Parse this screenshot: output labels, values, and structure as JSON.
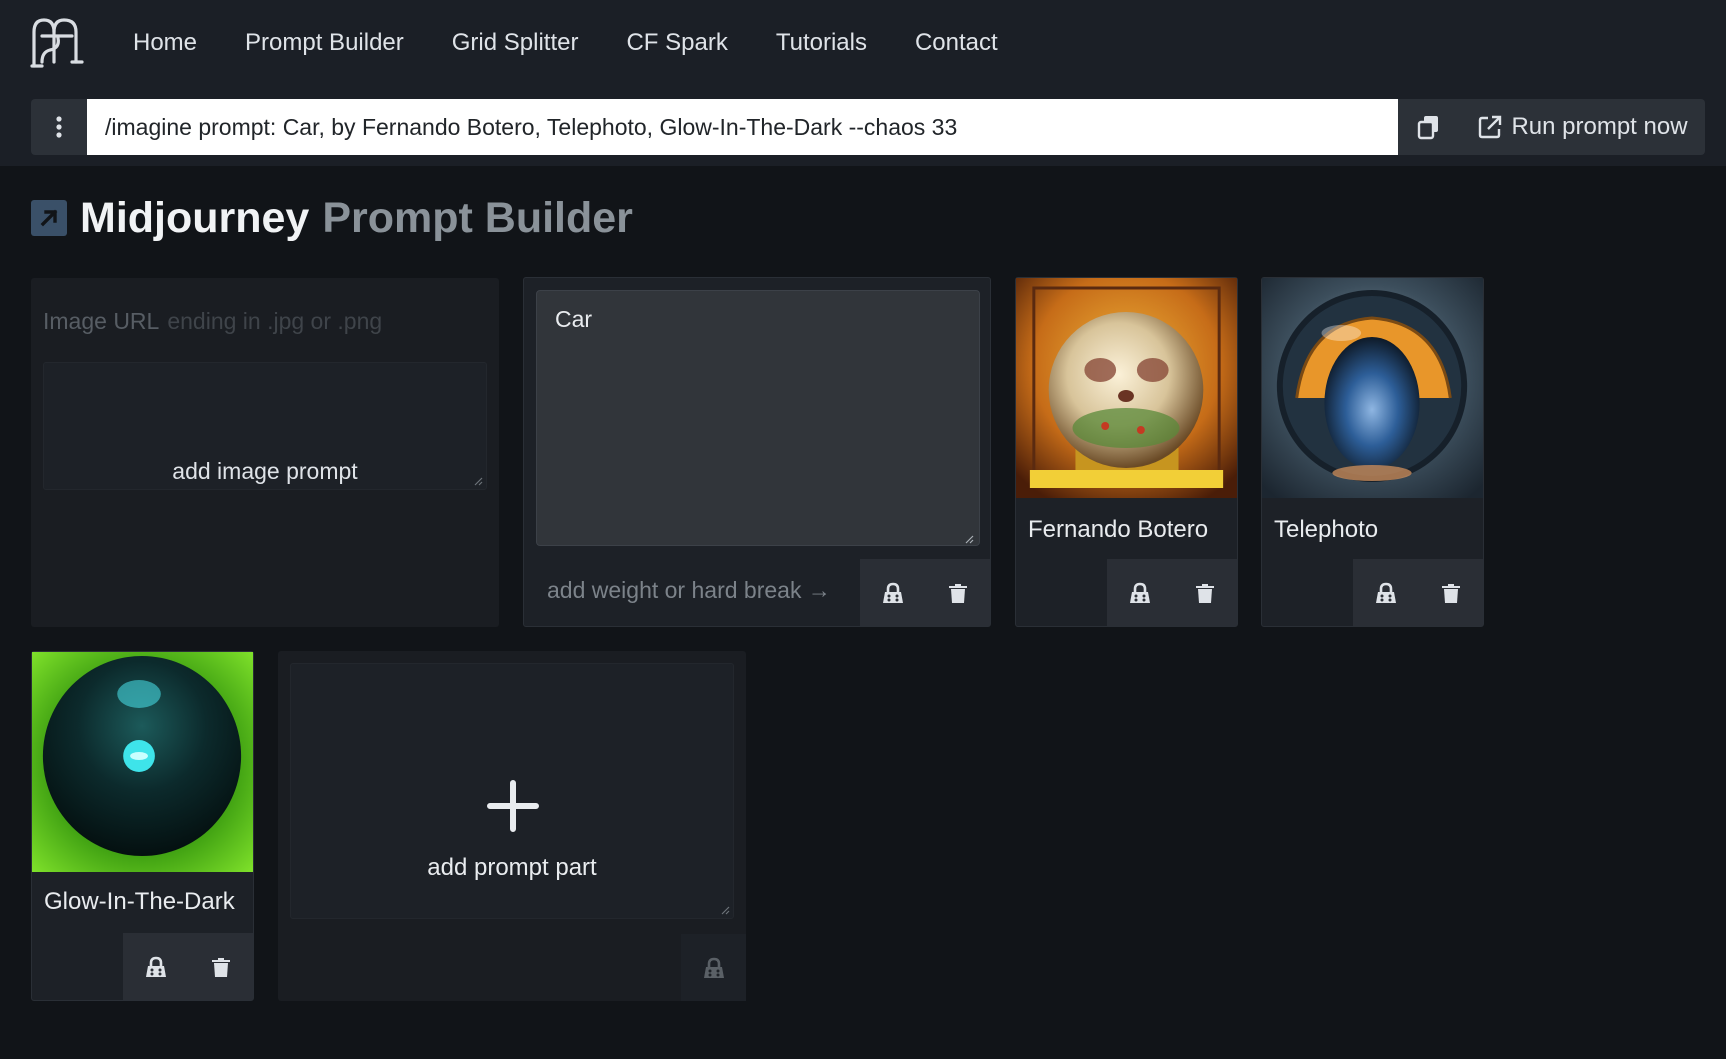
{
  "nav": {
    "logo": "mp-monogram-logo",
    "items": [
      {
        "label": "Home"
      },
      {
        "label": "Prompt Builder"
      },
      {
        "label": "Grid Splitter"
      },
      {
        "label": "CF Spark"
      },
      {
        "label": "Tutorials"
      },
      {
        "label": "Contact"
      }
    ]
  },
  "prompt_bar": {
    "menu_icon": "vertical-dots-icon",
    "value": "/imagine prompt: Car, by Fernando Botero, Telephoto, Glow-In-The-Dark --chaos 33",
    "copy_icon": "copy-icon",
    "run_icon": "external-link-icon",
    "run_label": "Run prompt now"
  },
  "page": {
    "title_main": "Midjourney",
    "title_sub": "Prompt Builder",
    "title_icon": "arrow-up-right-icon"
  },
  "image_prompt": {
    "label": "Image URL",
    "placeholder": "ending in .jpg or .png",
    "add_label": "add image prompt"
  },
  "text_part": {
    "value": "Car",
    "weight_hint": "add weight or hard break →",
    "lock_icon": "lock-icon",
    "delete_icon": "trash-icon"
  },
  "style_cards": [
    {
      "label": "Fernando Botero",
      "thumb_colors": [
        "#d89a2a",
        "#7a3a12",
        "#f3e6c8"
      ]
    },
    {
      "label": "Telephoto",
      "thumb_colors": [
        "#2a3a4a",
        "#e79a2c",
        "#3e6fa8"
      ]
    },
    {
      "label": "Glow-In-The-Dark",
      "thumb_colors": [
        "#5fc21a",
        "#0c2b2a",
        "#3fe0e6"
      ]
    }
  ],
  "add_part": {
    "plus_icon": "plus-icon",
    "label": "add prompt part",
    "lock_icon": "lock-icon"
  },
  "colors": {
    "background": "#111418",
    "topbar": "#1b1f26",
    "card": "#1d2127",
    "button": "#2a2e35",
    "muted_title": "#8a9299"
  }
}
